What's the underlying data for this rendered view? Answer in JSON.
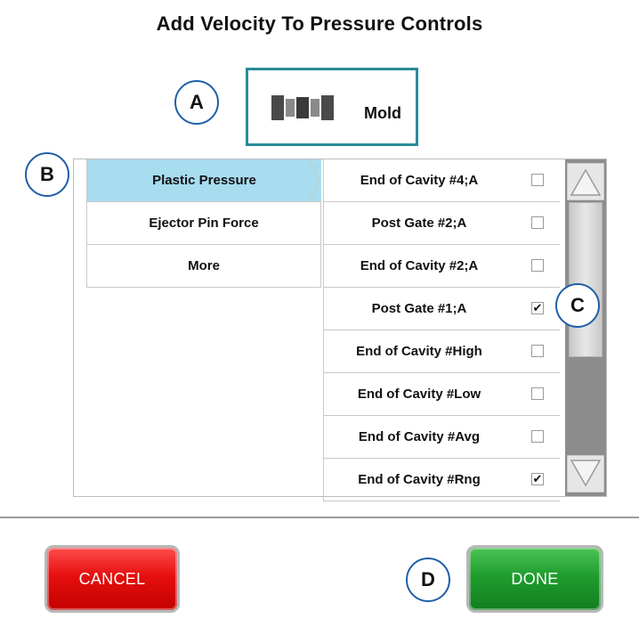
{
  "title": "Add Velocity To Pressure Controls",
  "callouts": {
    "a": "A",
    "b": "B",
    "c": "C",
    "d": "D"
  },
  "mold_button": {
    "label": "Mold",
    "icon": "mold-icon"
  },
  "categories": [
    {
      "label": "Plastic Pressure",
      "selected": true
    },
    {
      "label": "Ejector Pin Force",
      "selected": false
    },
    {
      "label": "More",
      "selected": false
    }
  ],
  "channels": [
    {
      "label": "End of Cavity #4;A",
      "checked": false
    },
    {
      "label": "Post Gate #2;A",
      "checked": false
    },
    {
      "label": "End of Cavity #2;A",
      "checked": false
    },
    {
      "label": "Post Gate #1;A",
      "checked": true
    },
    {
      "label": "End of Cavity #High",
      "checked": false
    },
    {
      "label": "End of Cavity #Low",
      "checked": false
    },
    {
      "label": "End of Cavity #Avg",
      "checked": false
    },
    {
      "label": "End of Cavity #Rng",
      "checked": true
    }
  ],
  "checkmark": "✔",
  "buttons": {
    "cancel": "CANCEL",
    "done": "DONE"
  },
  "colors": {
    "selected_category": "#a8dcef",
    "mold_border": "#2a8a99",
    "cancel": "#e60f0f",
    "done": "#1f9e2e",
    "callout_border": "#1f5fa8"
  }
}
